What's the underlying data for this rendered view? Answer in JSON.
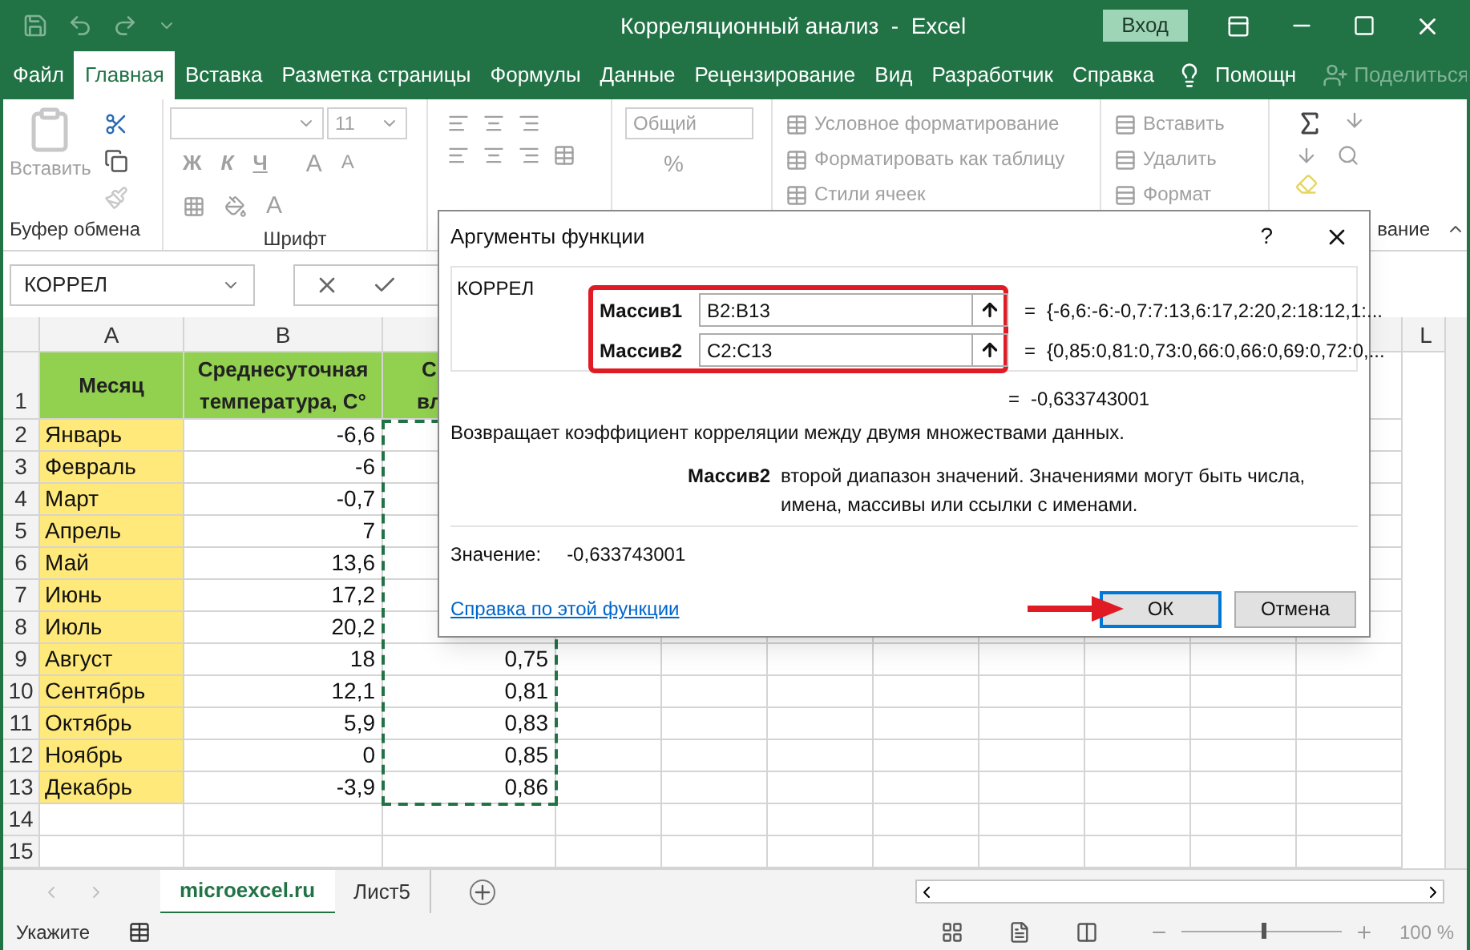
{
  "window": {
    "title": "Корреляционный анализ  -  Excel",
    "sign_in": "Вход"
  },
  "ribbon_tabs": [
    {
      "label": "Файл",
      "selected": false
    },
    {
      "label": "Главная",
      "selected": true
    },
    {
      "label": "Вставка",
      "selected": false
    },
    {
      "label": "Разметка страницы",
      "selected": false
    },
    {
      "label": "Формулы",
      "selected": false
    },
    {
      "label": "Данные",
      "selected": false
    },
    {
      "label": "Рецензирование",
      "selected": false
    },
    {
      "label": "Вид",
      "selected": false
    },
    {
      "label": "Разработчик",
      "selected": false
    },
    {
      "label": "Справка",
      "selected": false
    }
  ],
  "tell_me": "Помощн",
  "share": "Поделиться",
  "ribbon": {
    "clipboard": {
      "paste": "Вставить",
      "group": "Буфер обмена"
    },
    "font": {
      "size": "11",
      "bold": "Ж",
      "italic": "К",
      "underline": "Ч",
      "grow": "A",
      "shrink": "A",
      "text_color": "A",
      "group": "Шрифт"
    },
    "number": {
      "format": "Общий",
      "percent": "%"
    },
    "styles": [
      "Условное форматирование",
      "Форматировать как таблицу",
      "Стили ячеек"
    ],
    "cells": [
      "Вставить",
      "Удалить",
      "Формат"
    ],
    "editing": {
      "group": "вание"
    }
  },
  "name_box": "КОРРЕЛ",
  "columns": [
    "A",
    "B",
    "L"
  ],
  "header_row": {
    "row": "1",
    "month": "Месяц",
    "temp": "Среднесуточная температура, С°",
    "column_3": [
      "С",
      "вл"
    ]
  },
  "rows": [
    {
      "row": "2",
      "month": "Январь",
      "temp": "-6,6"
    },
    {
      "row": "3",
      "month": "Февраль",
      "temp": "-6"
    },
    {
      "row": "4",
      "month": "Март",
      "temp": "-0,7"
    },
    {
      "row": "5",
      "month": "Апрель",
      "temp": "7"
    },
    {
      "row": "6",
      "month": "Май",
      "temp": "13,6"
    },
    {
      "row": "7",
      "month": "Июнь",
      "temp": "17,2"
    },
    {
      "row": "8",
      "month": "Июль",
      "temp": "20,2"
    },
    {
      "row": "9",
      "month": "Август",
      "temp": "18",
      "column_3": "0,75"
    },
    {
      "row": "10",
      "month": "Сентябрь",
      "temp": "12,1",
      "column_3": "0,81"
    },
    {
      "row": "11",
      "month": "Октябрь",
      "temp": "5,9",
      "column_3": "0,83"
    },
    {
      "row": "12",
      "month": "Ноябрь",
      "temp": "0",
      "column_3": "0,85"
    },
    {
      "row": "13",
      "month": "Декабрь",
      "temp": "-3,9",
      "column_3": "0,86"
    }
  ],
  "empty_rows": [
    "14",
    "15"
  ],
  "dialog": {
    "title": "Аргументы функции",
    "help": "?",
    "function": "КОРРЕЛ",
    "args": [
      {
        "label": "Массив1",
        "value": "B2:B13",
        "sign": "=",
        "result": "{-6,6:-6:-0,7:7:13,6:17,2:20,2:18:12,1:..."
      },
      {
        "label": "Массив2",
        "value": "C2:C13",
        "sign": "=",
        "result": "{0,85:0,81:0,73:0,66:0,66:0,69:0,72:0,..."
      }
    ],
    "result": {
      "sign": "=",
      "value": "-0,633743001"
    },
    "description": "Возвращает коэффициент корреляции между двумя множествами данных.",
    "arg_help": {
      "name": "Массив2",
      "text": "второй диапазон значений. Значениями могут быть числа, имена, массивы или ссылки с именами."
    },
    "value_label": "Значение:",
    "value": "-0,633743001",
    "help_link": "Справка по этой функции",
    "buttons": [
      {
        "label": "ОК",
        "kind": "default"
      },
      {
        "label": "Отмена",
        "kind": "normal"
      }
    ]
  },
  "sheet_tabs": [
    {
      "label": "microexcel.ru",
      "selected": true
    },
    {
      "label": "Лист5",
      "selected": false
    }
  ],
  "status": "Укажите",
  "zoom": {
    "level": 0.5,
    "reading": "100 %"
  }
}
